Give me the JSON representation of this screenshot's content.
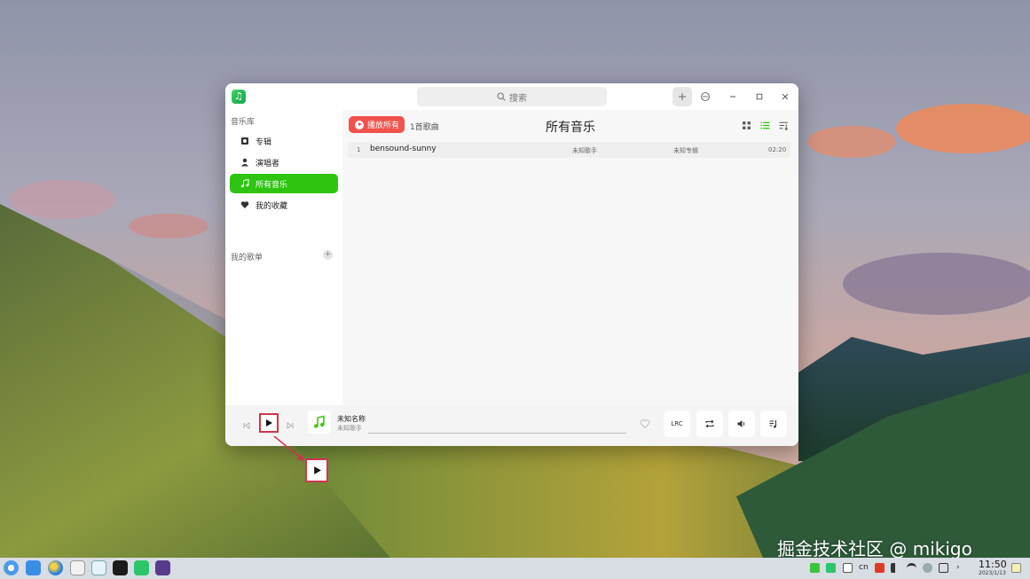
{
  "app": {
    "search_placeholder": "搜索"
  },
  "sidebar": {
    "library_heading": "音乐库",
    "items": [
      {
        "label": "专辑",
        "icon": "album-icon"
      },
      {
        "label": "演唱者",
        "icon": "person-icon"
      },
      {
        "label": "所有音乐",
        "icon": "music-note-icon",
        "active": true
      },
      {
        "label": "我的收藏",
        "icon": "heart-icon"
      }
    ],
    "playlists_heading": "我的歌单",
    "add_glyph": "+"
  },
  "main": {
    "play_all_label": "播放所有",
    "song_count": "1首歌曲",
    "title": "所有音乐",
    "songs": [
      {
        "index": "1",
        "title": "bensound-sunny",
        "artist": "未知歌手",
        "album": "未知专辑",
        "duration": "02:20"
      }
    ]
  },
  "player": {
    "title": "未知名称",
    "artist": "未知歌手",
    "lyrics_label": "LRC"
  },
  "overlay": {
    "watermark": "掘金技术社区 @ mikigo"
  },
  "taskbar": {
    "input_method": "cn",
    "time": "11:50",
    "date": "2023/1/13"
  },
  "colors": {
    "accent_green": "#2ec411",
    "play_all_red": "#f0534d",
    "highlight_box": "#d0344f"
  }
}
